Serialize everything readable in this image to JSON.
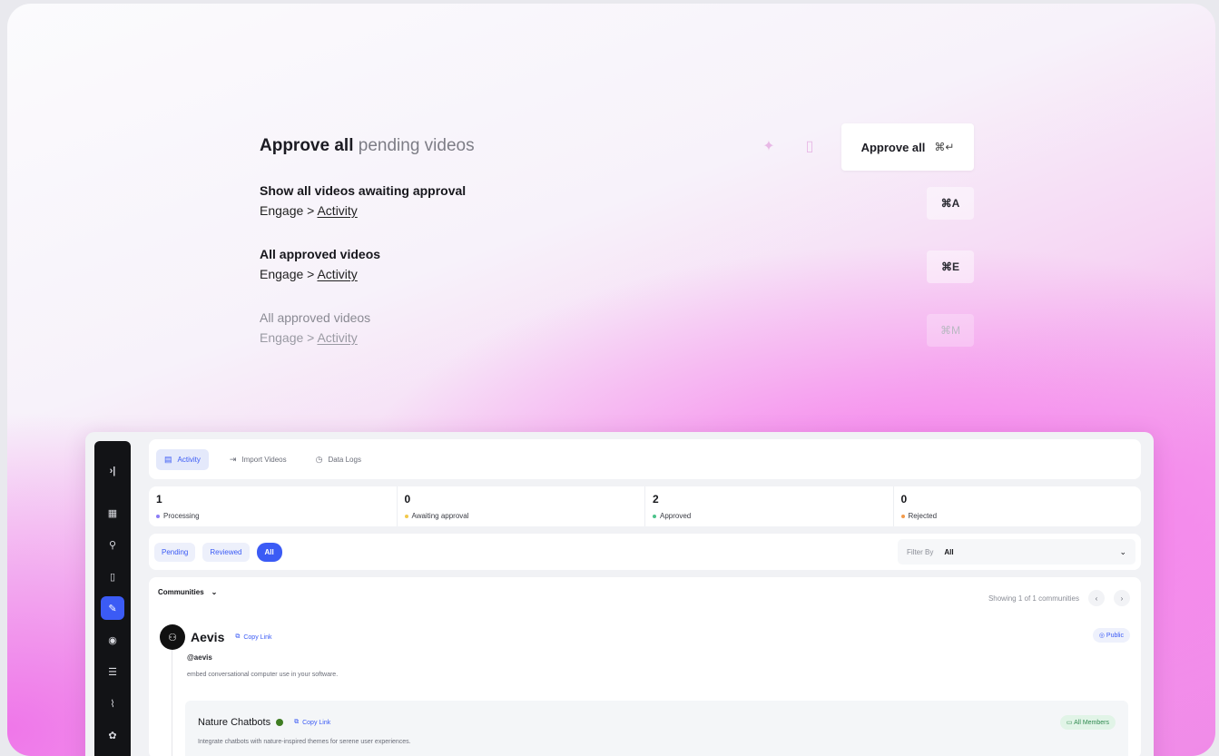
{
  "palette": {
    "title_bold": "Approve all",
    "title_light": "pending videos",
    "approve_button": {
      "label": "Approve all",
      "shortcut": "⌘↵"
    },
    "rows": [
      {
        "title": "Show all videos awaiting approval",
        "path_prefix": "Engage >",
        "path_link": "Activity",
        "shortcut": "⌘A"
      },
      {
        "title": "All approved videos",
        "path_prefix": "Engage >",
        "path_link": "Activity",
        "shortcut": "⌘E"
      },
      {
        "title": "All approved videos",
        "path_prefix": "Engage >",
        "path_link": "Activity",
        "shortcut": "⌘M"
      }
    ]
  },
  "app": {
    "tabs": [
      {
        "label": "Activity",
        "icon": "activity-icon"
      },
      {
        "label": "Import Videos",
        "icon": "import-icon"
      },
      {
        "label": "Data Logs",
        "icon": "history-icon"
      }
    ],
    "stats": [
      {
        "value": "1",
        "label": "Processing",
        "color": "#8b7cf6"
      },
      {
        "value": "0",
        "label": "Awaiting approval",
        "color": "#f2c94c"
      },
      {
        "value": "2",
        "label": "Approved",
        "color": "#4cc38a"
      },
      {
        "value": "0",
        "label": "Rejected",
        "color": "#f29a4a"
      }
    ],
    "filters": {
      "pending": "Pending",
      "reviewed": "Reviewed",
      "all": "All",
      "filter_label": "Filter By",
      "filter_value": "All"
    },
    "communities": {
      "heading": "Communities",
      "showing": "Showing 1 of 1 communities",
      "org": {
        "name": "Aevis",
        "copy_link": "Copy Link",
        "handle": "@aevis",
        "description": "embed conversational computer use in your software.",
        "visibility": "Public"
      },
      "sub": {
        "name": "Nature Chatbots",
        "copy_link": "Copy Link",
        "description": "Integrate chatbots with nature-inspired themes for serene user experiences.",
        "audience": "All Members"
      }
    },
    "accent": "#3b5bf5"
  }
}
